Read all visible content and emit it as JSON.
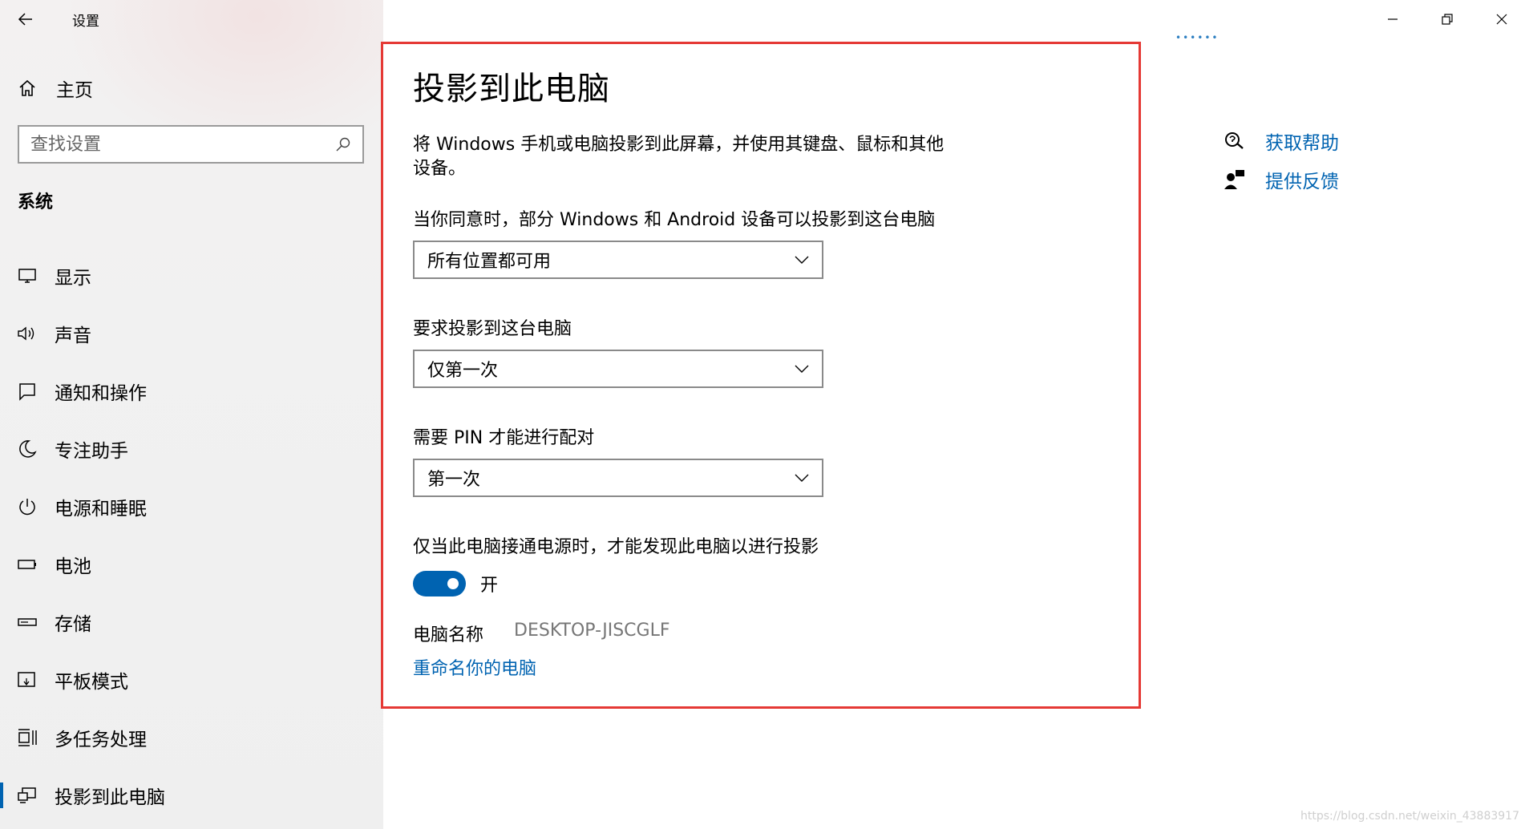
{
  "window": {
    "title": "设置",
    "back_icon": "back-arrow-icon",
    "minimize_icon": "minimize-icon",
    "restore_icon": "restore-icon",
    "close_icon": "close-icon"
  },
  "sidebar": {
    "home_label": "主页",
    "search_placeholder": "查找设置",
    "section_label": "系统",
    "items": [
      {
        "label": "显示",
        "icon": "display-icon"
      },
      {
        "label": "声音",
        "icon": "sound-icon"
      },
      {
        "label": "通知和操作",
        "icon": "notification-icon"
      },
      {
        "label": "专注助手",
        "icon": "focus-moon-icon"
      },
      {
        "label": "电源和睡眠",
        "icon": "power-icon"
      },
      {
        "label": "电池",
        "icon": "battery-icon"
      },
      {
        "label": "存储",
        "icon": "storage-icon"
      },
      {
        "label": "平板模式",
        "icon": "tablet-icon"
      },
      {
        "label": "多任务处理",
        "icon": "multitask-icon"
      },
      {
        "label": "投影到此电脑",
        "icon": "project-icon",
        "active": true
      }
    ]
  },
  "main": {
    "title": "投影到此电脑",
    "description": "将 Windows 手机或电脑投影到此屏幕，并使用其键盘、鼠标和其他设备。",
    "setting1": {
      "label": "当你同意时，部分 Windows 和 Android 设备可以投影到这台电脑",
      "value": "所有位置都可用"
    },
    "setting2": {
      "label": "要求投影到这台电脑",
      "value": "仅第一次"
    },
    "setting3": {
      "label": "需要 PIN 才能进行配对",
      "value": "第一次"
    },
    "setting4": {
      "label": "仅当此电脑接通电源时，才能发现此电脑以进行投影",
      "toggle_on": true,
      "state_label": "开"
    },
    "pc_name_label": "电脑名称",
    "pc_name_value": "DESKTOP-JISCGLF",
    "rename_link": "重命名你的电脑"
  },
  "help": {
    "get_help": "获取帮助",
    "feedback": "提供反馈"
  },
  "watermark": "https://blog.csdn.net/weixin_43883917",
  "colors": {
    "accent": "#0063b1",
    "highlight_border": "#e53935"
  }
}
